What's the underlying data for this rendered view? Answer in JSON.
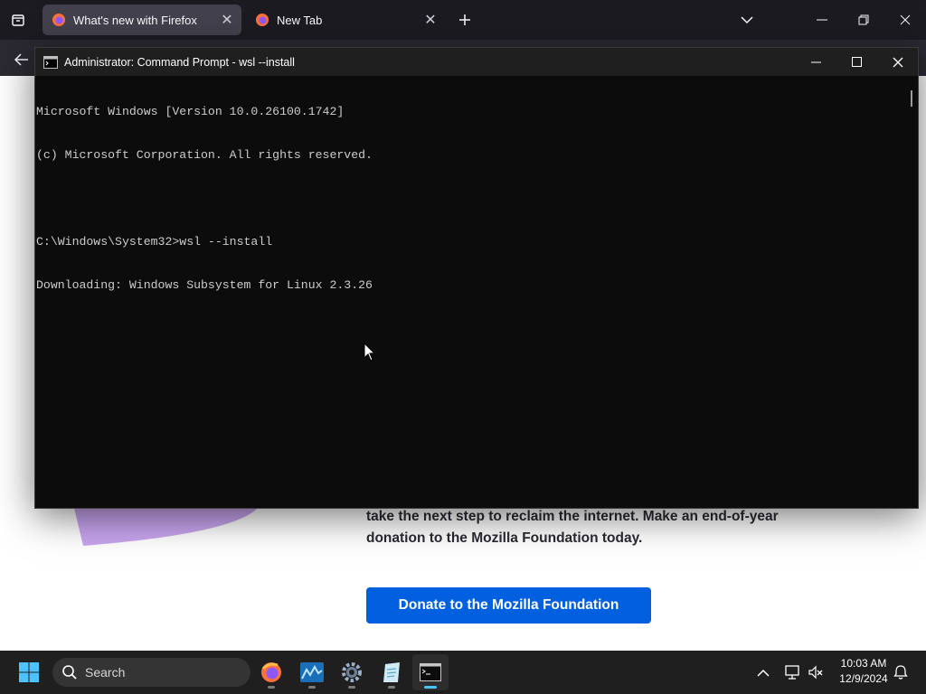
{
  "firefox": {
    "tabs": [
      {
        "label": "What's new with Firefox",
        "active": true
      },
      {
        "label": "New Tab",
        "active": false
      }
    ],
    "page": {
      "text": "take the next step to reclaim the internet. Make an end-of-year donation to the Mozilla Foundation today.",
      "donate_button": "Donate to the Mozilla Foundation"
    }
  },
  "cmd": {
    "title": "Administrator: Command Prompt - wsl  --install",
    "lines": [
      "Microsoft Windows [Version 10.0.26100.1742]",
      "(c) Microsoft Corporation. All rights reserved.",
      "",
      "C:\\Windows\\System32>wsl --install",
      "Downloading: Windows Subsystem for Linux 2.3.26"
    ]
  },
  "taskbar": {
    "search_label": "Search",
    "time": "10:03 AM",
    "date": "12/9/2024",
    "apps": [
      "firefox-icon",
      "app-chart-icon",
      "settings-icon",
      "notepad-icon",
      "terminal-icon"
    ]
  },
  "colors": {
    "accent": "#0060df",
    "cmd_bg": "#0c0c0c",
    "taskbar_bg": "#1f1f1f",
    "taskbar_active_indicator": "#4cc2ff"
  }
}
